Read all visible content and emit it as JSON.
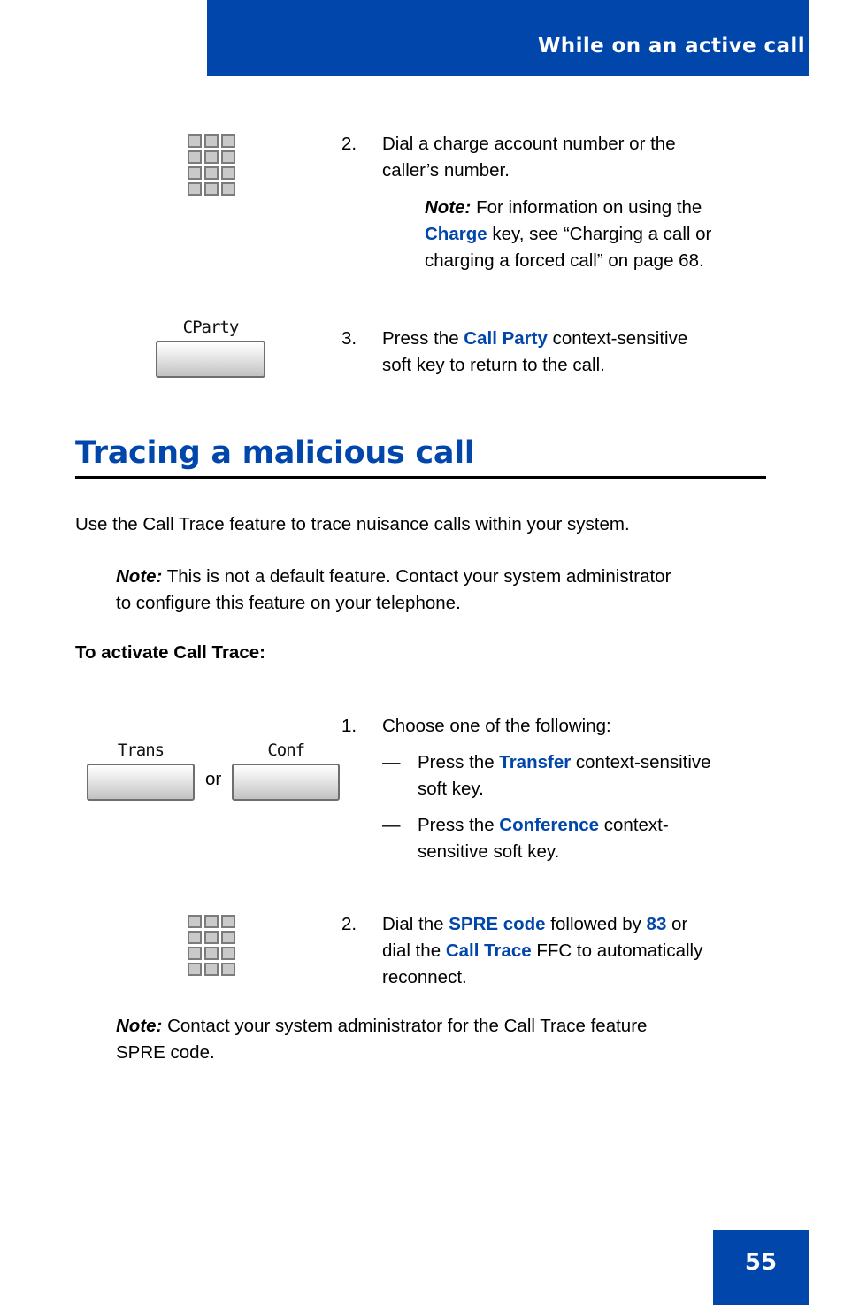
{
  "header": {
    "title": "While on an active call"
  },
  "footer": {
    "page_number": "55"
  },
  "colors": {
    "brand_blue": "#0046ab",
    "key_gray": "#7b7b7b"
  },
  "steps_top": [
    {
      "number": "2.",
      "icon": "keypad-icon",
      "line1": "Dial a charge account number or the",
      "line2": "caller’s number.",
      "note_label": "Note:",
      "note_text_1": " For information on using the",
      "note_key": "Charge",
      "note_text_2": " key, see “Charging a call or",
      "note_text_3": "charging a forced call” on page 68."
    },
    {
      "number": "3.",
      "icon": "softkey-icon",
      "softkey_label": "CParty",
      "text_pre": "Press the ",
      "text_key": "Call Party",
      "text_post": " context-sensitive",
      "text_line2": "soft key to return to the call."
    }
  ],
  "section": {
    "heading": "Tracing a malicious call",
    "intro": "Use the Call Trace feature to trace nuisance calls within your system.",
    "note_label": "Note:",
    "note_line1": "  This is not a default feature. Contact your system administrator",
    "note_line2": "to configure this feature on your telephone.",
    "subhead": "To activate Call Trace:"
  },
  "steps_bottom": [
    {
      "number": "1.",
      "prompt": "Choose one of the following:",
      "softkey_left_label": "Trans",
      "or_label": "or",
      "softkey_right_label": "Conf",
      "bullets": [
        {
          "dash": "—",
          "pre": "Press the ",
          "key": "Transfer",
          "post": " context-sensitive",
          "line2": "soft key."
        },
        {
          "dash": "—",
          "pre": "Press the ",
          "key": "Conference",
          "post": " context-",
          "line2": "sensitive soft key."
        }
      ]
    },
    {
      "number": "2.",
      "icon": "keypad-icon",
      "pre": "Dial the ",
      "key1": "SPRE code",
      "mid1": " followed by ",
      "key2": "83",
      "mid2": " or",
      "line2_pre": "dial the ",
      "line2_key": "Call Trace",
      "line2_post": " FFC to automatically",
      "line3": "reconnect."
    }
  ],
  "final_note": {
    "label": "Note:",
    "line1": " Contact your system administrator for the Call Trace feature",
    "line2": "SPRE code."
  }
}
